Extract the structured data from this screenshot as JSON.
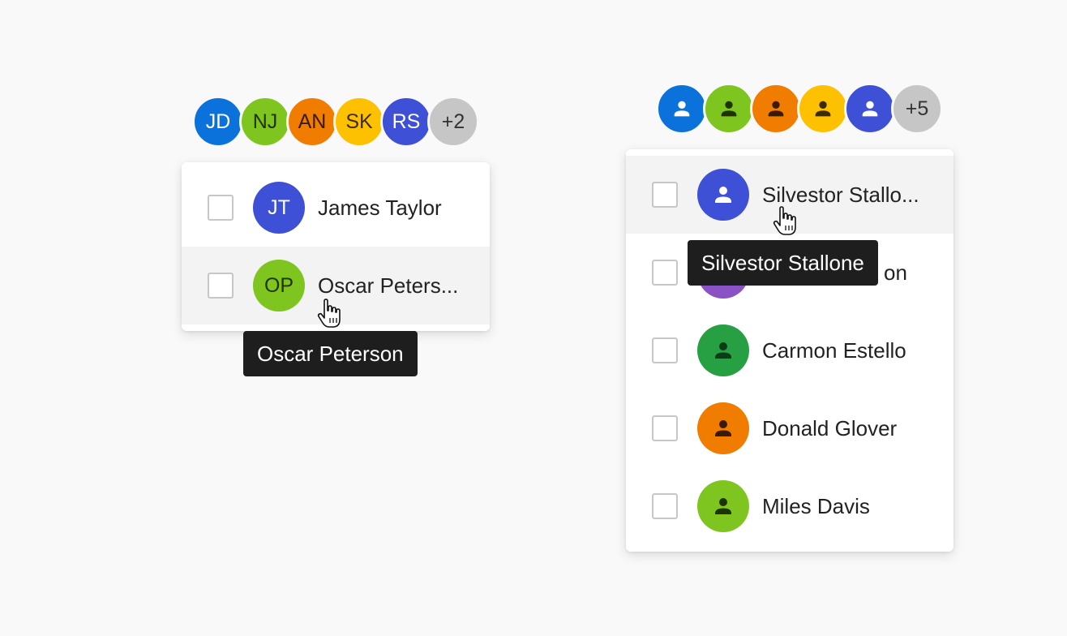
{
  "colors": {
    "blue": "#0b72dc",
    "lime": "#7ec61f",
    "orange": "#f07c00",
    "yellow": "#fdc102",
    "indigo": "#3d50d6",
    "gray": "#c6c6c6",
    "green": "#27a043",
    "purple": "#8a52c4"
  },
  "left_group": {
    "stack": [
      {
        "initials": "JD",
        "color": "#0b72dc",
        "text_color": "#ffffff"
      },
      {
        "initials": "NJ",
        "color": "#7ec61f",
        "text_color": "#1f3300"
      },
      {
        "initials": "AN",
        "color": "#f07c00",
        "text_color": "#3a1a00"
      },
      {
        "initials": "SK",
        "color": "#fdc102",
        "text_color": "#3d2b00"
      },
      {
        "initials": "RS",
        "color": "#3d50d6",
        "text_color": "#ffffff"
      }
    ],
    "overflow": "+2",
    "list": [
      {
        "initials": "JT",
        "name": "James Taylor",
        "color": "#3d50d6",
        "text_color": "#ffffff",
        "checked": false
      },
      {
        "initials": "OP",
        "name": "Oscar Peters...",
        "color": "#7ec61f",
        "text_color": "#1f3300",
        "checked": false
      }
    ],
    "tooltip": "Oscar Peterson"
  },
  "right_group": {
    "stack": [
      {
        "icon": "person-icon",
        "color": "#0b72dc",
        "icon_color": "#ffffff"
      },
      {
        "icon": "person-icon",
        "color": "#7ec61f",
        "icon_color": "#1f3300"
      },
      {
        "icon": "person-icon",
        "color": "#f07c00",
        "icon_color": "#3a1a00"
      },
      {
        "icon": "person-icon",
        "color": "#fdc102",
        "icon_color": "#3d2b00"
      },
      {
        "icon": "person-icon",
        "color": "#3d50d6",
        "icon_color": "#ffffff"
      }
    ],
    "overflow": "+5",
    "list": [
      {
        "icon": "person-icon",
        "name": "Silvestor Stallo...",
        "color": "#3d50d6",
        "icon_color": "#ffffff",
        "checked": false
      },
      {
        "icon": "person-icon",
        "name": "on",
        "color": "#8a52c4",
        "icon_color": "#ffffff",
        "checked": false
      },
      {
        "icon": "person-icon",
        "name": "Carmon Estello",
        "color": "#27a043",
        "icon_color": "#0e3a18",
        "checked": false
      },
      {
        "icon": "person-icon",
        "name": "Donald Glover",
        "color": "#f07c00",
        "icon_color": "#3a1a00",
        "checked": false
      },
      {
        "icon": "person-icon",
        "name": "Miles Davis",
        "color": "#7ec61f",
        "icon_color": "#1f3300",
        "checked": false
      }
    ],
    "tooltip": "Silvestor Stallone"
  }
}
